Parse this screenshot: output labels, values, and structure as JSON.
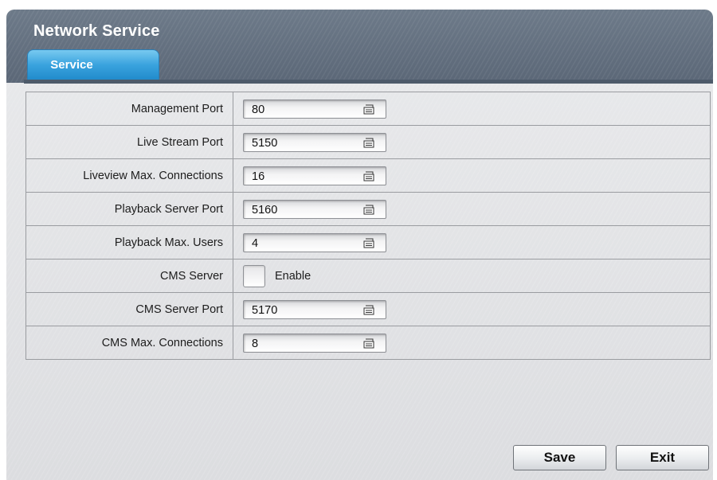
{
  "window": {
    "title": "Network Service"
  },
  "tabs": [
    {
      "label": "Service",
      "active": true
    }
  ],
  "rows": [
    {
      "label": "Management Port",
      "type": "input",
      "value": "80"
    },
    {
      "label": "Live Stream Port",
      "type": "input",
      "value": "5150"
    },
    {
      "label": "Liveview Max. Connections",
      "type": "input",
      "value": "16"
    },
    {
      "label": "Playback Server Port",
      "type": "input",
      "value": "5160"
    },
    {
      "label": "Playback Max. Users",
      "type": "input",
      "value": "4"
    },
    {
      "label": "CMS Server",
      "type": "checkbox",
      "checked": false,
      "checkbox_label": "Enable"
    },
    {
      "label": "CMS Server Port",
      "type": "input",
      "value": "5170"
    },
    {
      "label": "CMS Max. Connections",
      "type": "input",
      "value": "8"
    }
  ],
  "buttons": {
    "save": "Save",
    "exit": "Exit"
  },
  "icons": {
    "field_icon": "keyboard-icon"
  },
  "colors": {
    "header": "#5f6b7b",
    "tab_active": "#2f98d6",
    "background": "#e2e3e5"
  }
}
